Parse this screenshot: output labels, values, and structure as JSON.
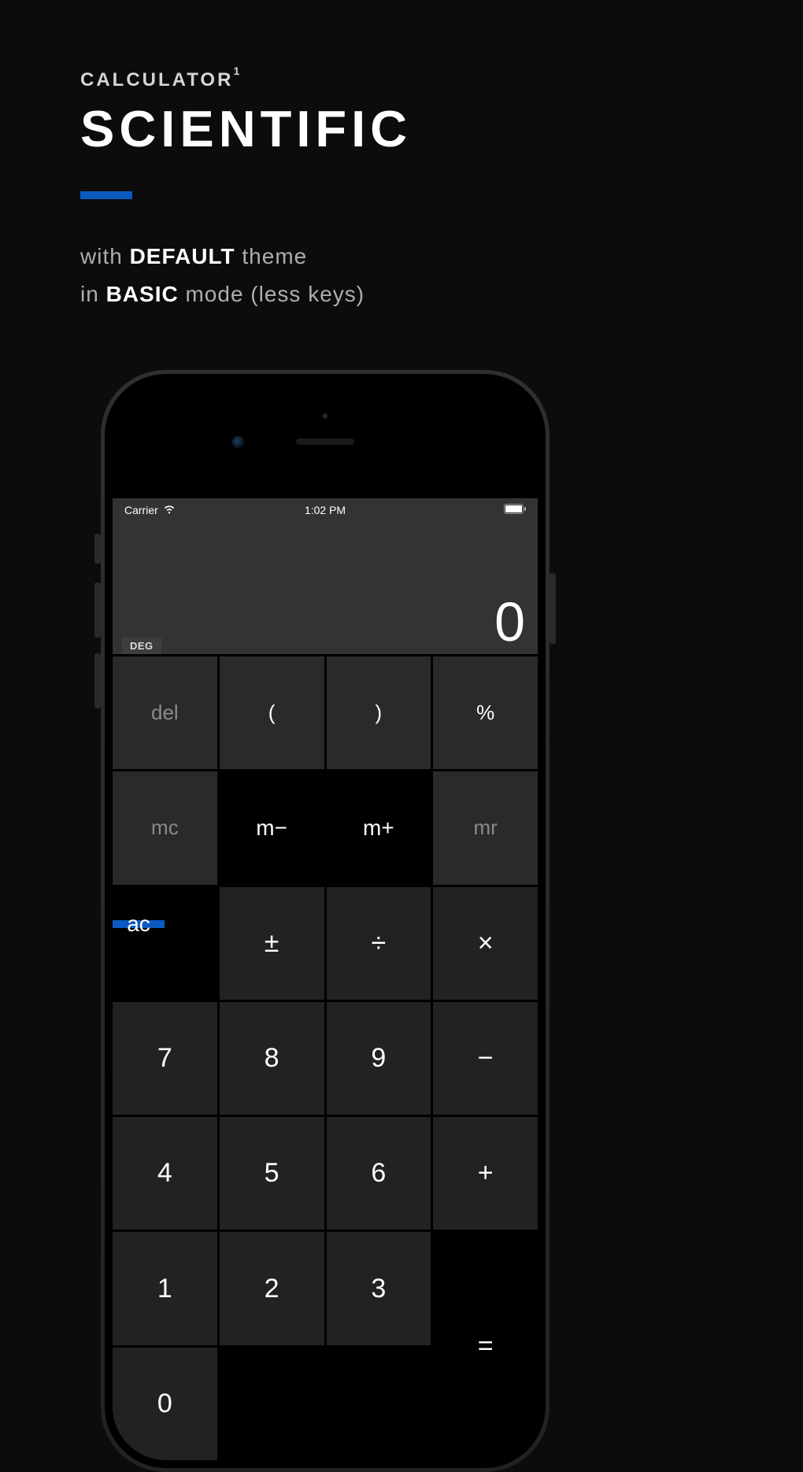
{
  "header": {
    "supertitle": "CALCULATOR",
    "superscript": "1",
    "title": "SCIENTIFIC"
  },
  "tagline": {
    "line1_pre": "with ",
    "line1_strong": "DEFAULT",
    "line1_post": " theme",
    "line2_pre": "in ",
    "line2_strong": "BASIC",
    "line2_post": " mode (less keys)"
  },
  "phone": {
    "status": {
      "carrier": "Carrier",
      "time": "1:02 PM"
    },
    "display_value": "0",
    "angle_mode": "DEG",
    "keys": {
      "del": "del",
      "lparen": "(",
      "rparen": ")",
      "percent": "%",
      "mc": "mc",
      "mminus": "m−",
      "mplus": "m+",
      "mr": "mr",
      "ac": "ac",
      "plusminus": "±",
      "divide": "÷",
      "multiply": "×",
      "7": "7",
      "8": "8",
      "9": "9",
      "minus": "−",
      "4": "4",
      "5": "5",
      "6": "6",
      "plus": "+",
      "1": "1",
      "2": "2",
      "3": "3",
      "equals": "=",
      "0": "0"
    }
  }
}
